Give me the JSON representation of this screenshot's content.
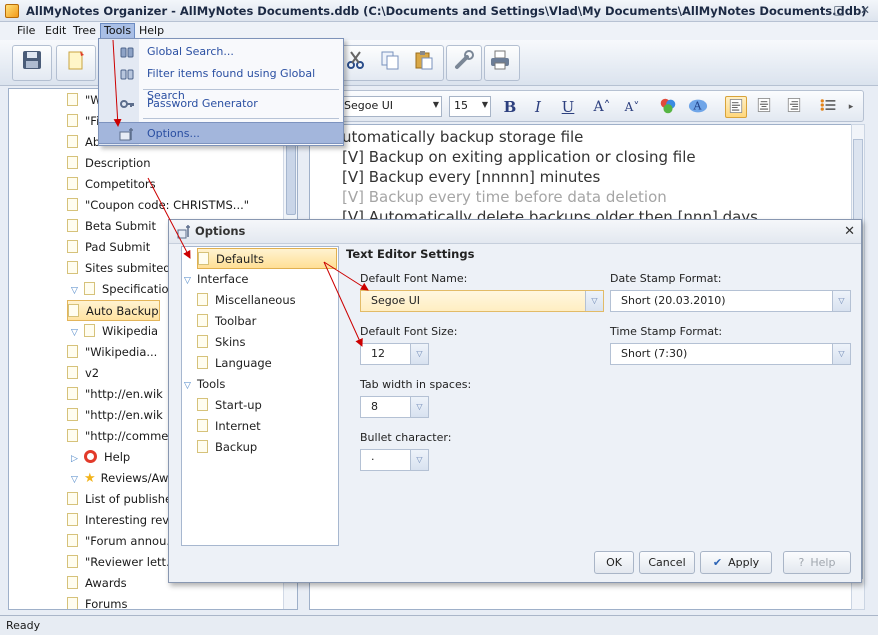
{
  "window": {
    "title": "AllMyNotes Organizer - AllMyNotes Documents.ddb (C:\\Documents and Settings\\Vlad\\My Documents\\AllMyNotes Documents.ddb)",
    "min_glyph": "–",
    "max_glyph": "□",
    "close_glyph": "✕"
  },
  "menu": [
    "File",
    "Edit",
    "Tree",
    "Tools",
    "Help"
  ],
  "tools_menu": {
    "items": [
      "Global Search...",
      "Filter items found using Global Search",
      "Password Generator",
      "Options..."
    ]
  },
  "format_bar": {
    "font_name": "Segoe UI",
    "font_size": "15",
    "bold": "B",
    "italic": "I",
    "underline": "U",
    "grow": "A˄",
    "shrink": "A˅"
  },
  "tree": {
    "items": [
      {
        "label": "\"Wi...",
        "indent": 2
      },
      {
        "label": "\"Fi...",
        "indent": 2
      },
      {
        "label": "Ab...",
        "indent": 2
      },
      {
        "label": "Description",
        "indent": 2
      },
      {
        "label": "Competitors",
        "indent": 2
      },
      {
        "label": "\"Coupon code: CHRISTMS...\"",
        "indent": 2
      },
      {
        "label": "Beta Submit",
        "indent": 2
      },
      {
        "label": "Pad Submit",
        "indent": 2
      },
      {
        "label": "Sites submited",
        "indent": 2
      },
      {
        "label": "Specifications",
        "indent": 1,
        "expanded": true
      },
      {
        "label": "Auto Backup",
        "indent": 2,
        "selected": true
      },
      {
        "label": "Wikipedia",
        "indent": 1,
        "expanded": true
      },
      {
        "label": "\"Wikipedia...",
        "indent": 2
      },
      {
        "label": "v2",
        "indent": 2
      },
      {
        "label": "\"http://en.wik",
        "indent": 2
      },
      {
        "label": "\"http://en.wik",
        "indent": 2
      },
      {
        "label": "\"http://comme",
        "indent": 2
      },
      {
        "label": "Help",
        "indent": 1,
        "expanded": false,
        "icon": "help"
      },
      {
        "label": "Reviews/Awa...",
        "indent": 1,
        "expanded": true,
        "icon": "star"
      },
      {
        "label": "List of publishe...",
        "indent": 2
      },
      {
        "label": "Interesting rev...",
        "indent": 2
      },
      {
        "label": "\"Forum annou...",
        "indent": 2
      },
      {
        "label": "\"Reviewer lett...",
        "indent": 2
      },
      {
        "label": "Awards",
        "indent": 2
      },
      {
        "label": "Forums",
        "indent": 2
      }
    ]
  },
  "editor": {
    "lines": [
      {
        "text": "utomatically backup storage file",
        "grey": false
      },
      {
        "text": "[V] Backup on exiting application or closing file",
        "grey": false
      },
      {
        "text": "[V] Backup every [nnnnn] minutes",
        "grey": false
      },
      {
        "text": "[V] Backup every time before data deletion",
        "grey": true
      },
      {
        "text": "[V] Automatically delete backups older then [nnn] days",
        "grey": false
      }
    ]
  },
  "status": "Ready",
  "options_dialog": {
    "title": "Options",
    "close": "✕",
    "tree": [
      {
        "label": "Defaults",
        "level": 1,
        "selected": true
      },
      {
        "label": "Interface",
        "level": 0,
        "expanded": true
      },
      {
        "label": "Miscellaneous",
        "level": 1
      },
      {
        "label": "Toolbar",
        "level": 1
      },
      {
        "label": "Skins",
        "level": 1
      },
      {
        "label": "Language",
        "level": 1
      },
      {
        "label": "Tools",
        "level": 0,
        "expanded": true
      },
      {
        "label": "Start-up",
        "level": 1
      },
      {
        "label": "Internet",
        "level": 1
      },
      {
        "label": "Backup",
        "level": 1
      }
    ],
    "section_title": "Text Editor Settings",
    "default_font_name_label": "Default Font Name:",
    "default_font_name": "Segoe UI",
    "default_font_size_label": "Default Font Size:",
    "default_font_size": "12",
    "tab_width_label": "Tab width in spaces:",
    "tab_width": "8",
    "bullet_label": "Bullet character:",
    "bullet": "·",
    "date_stamp_label": "Date Stamp Format:",
    "date_stamp": "Short (20.03.2010)",
    "time_stamp_label": "Time Stamp Format:",
    "time_stamp": "Short (7:30)",
    "buttons": {
      "ok": "OK",
      "cancel": "Cancel",
      "apply": "Apply",
      "help": "Help"
    }
  },
  "colors": {
    "arrow": "#cc0000",
    "selection": "#ffe3a1",
    "menu_highlight": "#a3b6dc"
  }
}
